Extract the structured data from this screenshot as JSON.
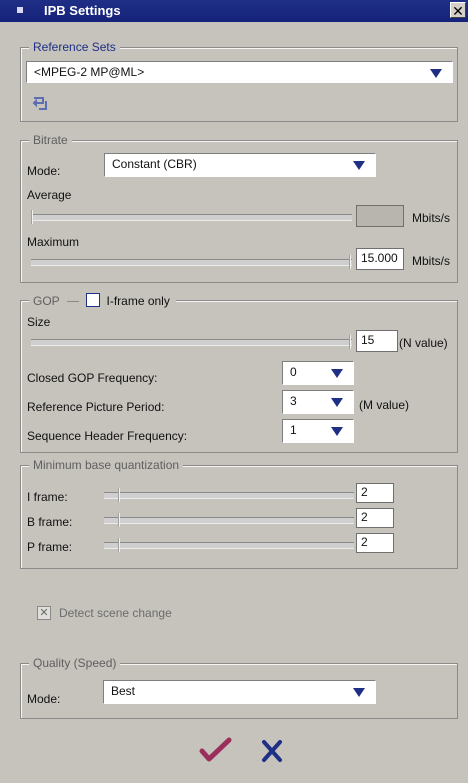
{
  "window": {
    "title": "IPB Settings"
  },
  "reference_sets": {
    "legend": "Reference Sets",
    "selected": "<MPEG-2 MP@ML>"
  },
  "bitrate": {
    "legend": "Bitrate",
    "mode_label": "Mode:",
    "mode_value": "Constant (CBR)",
    "average_label": "Average",
    "average_value": "",
    "average_unit": "Mbits/s",
    "maximum_label": "Maximum",
    "maximum_value": "15.000",
    "maximum_unit": "Mbits/s"
  },
  "gop": {
    "legend": "GOP",
    "iframe_only_label": "I-frame only",
    "size_label": "Size",
    "size_value": "15",
    "size_unit": "(N value)",
    "closed_gop_label": "Closed GOP Frequency:",
    "closed_gop_value": "0",
    "ref_picture_label": "Reference Picture Period:",
    "ref_picture_value": "3",
    "ref_picture_unit": "(M value)",
    "seq_header_label": "Sequence Header Frequency:",
    "seq_header_value": "1"
  },
  "quantization": {
    "legend": "Minimum base quantization",
    "i_label": "I frame:",
    "i_value": "2",
    "b_label": "B frame:",
    "b_value": "2",
    "p_label": "P frame:",
    "p_value": "2"
  },
  "scene_change": {
    "label": "Detect scene change"
  },
  "quality": {
    "legend": "Quality (Speed)",
    "mode_label": "Mode:",
    "mode_value": "Best"
  },
  "icons": {
    "title": "window-icon",
    "close": "close-icon",
    "reset": "reset-icon",
    "ok": "checkmark-icon",
    "cancel": "x-icon"
  },
  "colors": {
    "title_bar": "#1f2f86",
    "accent_check": "#9b2f5c",
    "accent_cancel": "#1f2f86"
  }
}
